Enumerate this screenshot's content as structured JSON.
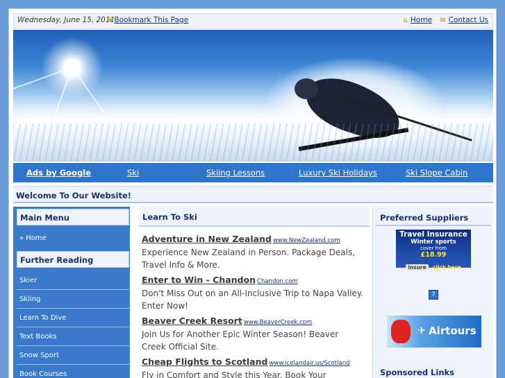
{
  "topbar": {
    "date": "Wednesday, June 15, 2011",
    "bookmark": "Bookmark This Page",
    "home": "Home",
    "contact": "Contact Us"
  },
  "adnav": {
    "items": [
      "Ads by Google",
      "Ski",
      "Skiing Lessons",
      "Luxury Ski Holidays",
      "Ski Slope Cabin"
    ]
  },
  "welcome": "Welcome To Our Website!",
  "leftmenu": {
    "main_heading": "Main Menu",
    "home": "Home",
    "further_heading": "Further Reading",
    "items": [
      "Skier",
      "Skiing",
      "Learn To Dive",
      "Text Books",
      "Snow Sport",
      "Book Courses"
    ]
  },
  "main": {
    "heading": "Learn To Ski",
    "ads": [
      {
        "title": "Adventure in New Zealand",
        "url": "www.NewZealand.com",
        "desc": "Experience New Zealand in Person. Package Deals, Travel Info & More."
      },
      {
        "title": "Enter to Win - Chandon",
        "url": "Chandon.com",
        "desc": "Don't Miss Out on an All-Inclusive Trip to Napa Valley. Enter Now!"
      },
      {
        "title": "Beaver Creek Resort",
        "url": "www.BeaverCreek.com",
        "desc": "Join Us for Another Epic Winter Season! Beaver Creek Official Site."
      },
      {
        "title": "Cheap Flights to Scotland",
        "url": "www.icelandair.us/Scotland",
        "desc": "Fly in Comfort and Style this Year. Book Your"
      }
    ]
  },
  "right": {
    "suppliers_heading": "Preferred Suppliers",
    "travel_ad": {
      "title": "Travel Insurance",
      "line1": "Winter sports",
      "line2": "cover from",
      "price": "£18.99",
      "brand": "insure",
      "cta": "click here"
    },
    "question_mark": "?",
    "airtours": "Airtours",
    "sponsored_heading": "Sponsored Links"
  }
}
